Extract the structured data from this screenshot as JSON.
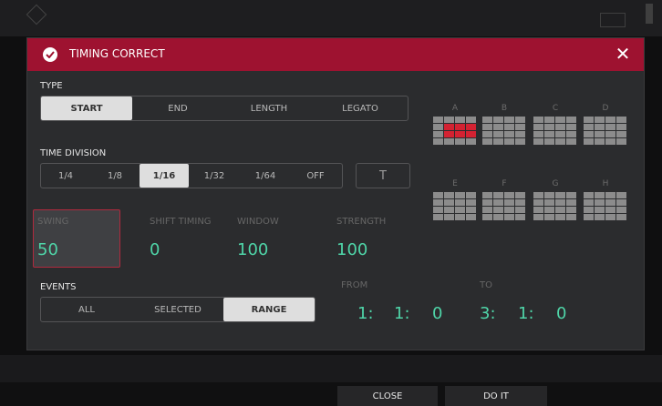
{
  "dialog": {
    "title": "TIMING CORRECT",
    "accent": "#9e1230",
    "value_color": "#4fd5a8",
    "close_icon_glyph": "✕"
  },
  "type": {
    "label": "TYPE",
    "options": [
      "START",
      "END",
      "LENGTH",
      "LEGATO"
    ],
    "selected": "START"
  },
  "time_division": {
    "label": "TIME DIVISION",
    "options": [
      "1/4",
      "1/8",
      "1/16",
      "1/32",
      "1/64",
      "OFF"
    ],
    "selected": "1/16",
    "triplet_label": "T"
  },
  "params": {
    "swing": {
      "label": "SWING",
      "value": "50"
    },
    "shift_timing": {
      "label": "SHIFT TIMING",
      "value": "0"
    },
    "window": {
      "label": "WINDOW",
      "value": "100"
    },
    "strength": {
      "label": "STRENGTH",
      "value": "100"
    }
  },
  "events": {
    "label": "EVENTS",
    "options": [
      "ALL",
      "SELECTED",
      "RANGE"
    ],
    "selected": "RANGE"
  },
  "range": {
    "from_label": "FROM",
    "from": [
      "1:",
      "1:",
      "0"
    ],
    "to_label": "TO",
    "to": [
      "3:",
      "1:",
      "0"
    ]
  },
  "pad_banks": {
    "labels": [
      "A",
      "B",
      "C",
      "D",
      "E",
      "F",
      "G",
      "H"
    ],
    "highlighted_bank": "A",
    "highlighted_pads": [
      5,
      6,
      7,
      9,
      10,
      11
    ]
  },
  "footer": {
    "close_label": "CLOSE",
    "doit_label": "DO IT"
  }
}
